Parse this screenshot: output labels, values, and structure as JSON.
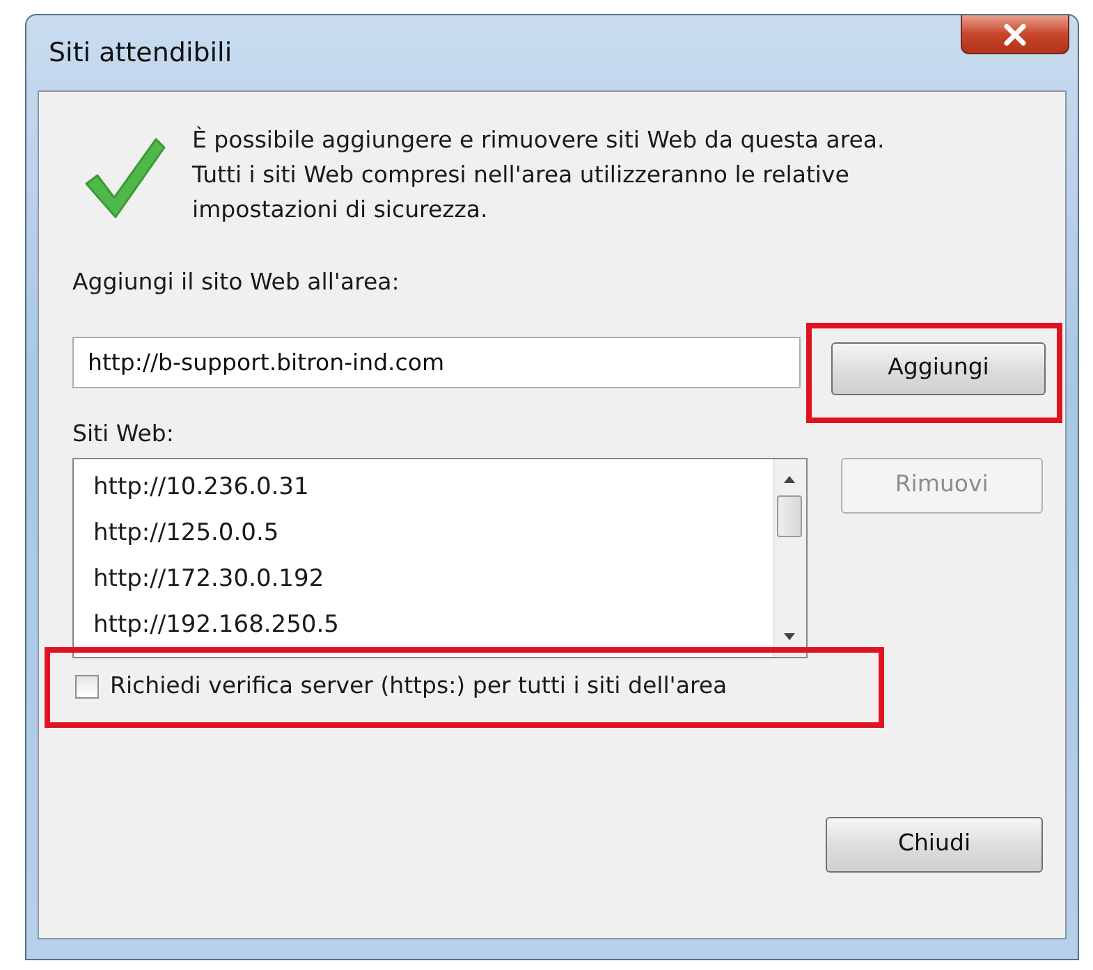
{
  "window": {
    "title": "Siti attendibili"
  },
  "message": {
    "lines": [
      "È possibile aggiungere e rimuovere siti Web da questa area.",
      "Tutti i siti Web compresi nell'area utilizzeranno le relative",
      "impostazioni di sicurezza."
    ]
  },
  "add_site": {
    "label": "Aggiungi il sito Web all'area:",
    "value": "http://b-support.bitron-ind.com",
    "button": {
      "label": "Aggiungi",
      "disabled": false,
      "highlighted": true
    }
  },
  "sites": {
    "label": "Siti Web:",
    "items": [
      {
        "text": "http://10.236.0.31",
        "selected": false
      },
      {
        "text": "http://125.0.0.5",
        "selected": false
      },
      {
        "text": "http://172.30.0.192",
        "selected": false
      },
      {
        "text": "http://192.168.250.5",
        "selected": false
      }
    ],
    "remove_button": {
      "label": "Rimuovi",
      "disabled": true
    }
  },
  "require_https": {
    "label": "Richiedi verifica server (https:) per tutti i siti dell'area",
    "checked": false,
    "highlighted": true
  },
  "close_button": {
    "label": "Chiudi",
    "disabled": false
  }
}
